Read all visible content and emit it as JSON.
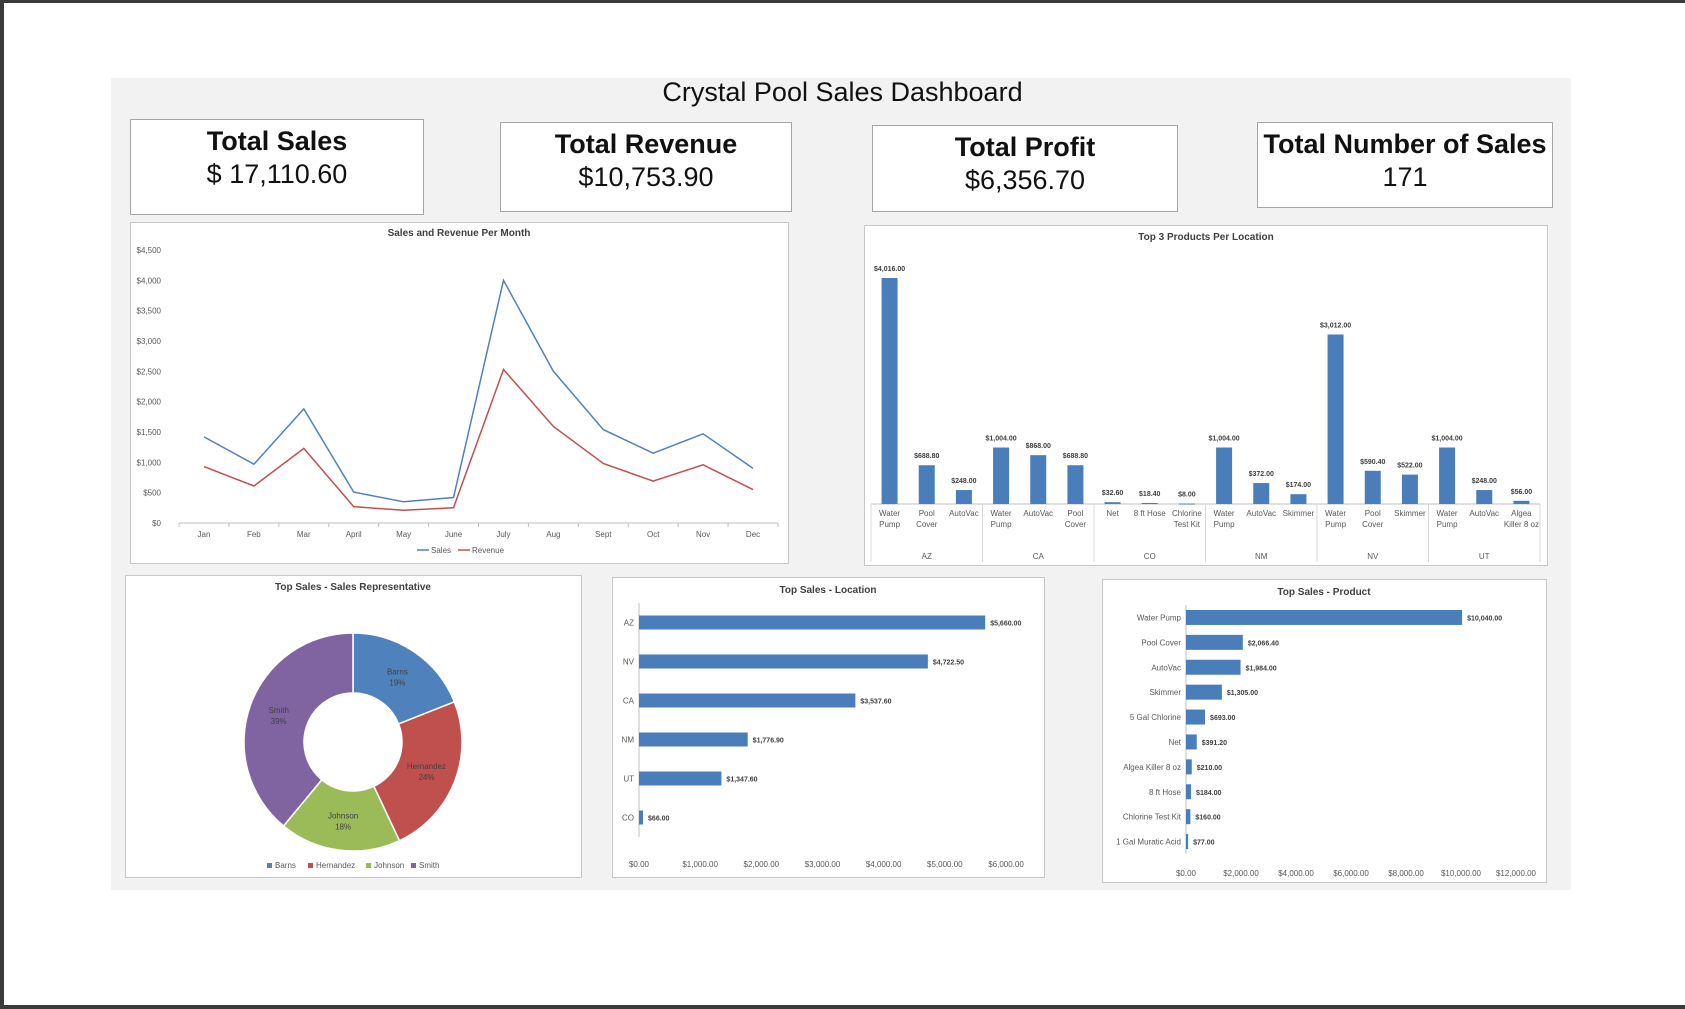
{
  "dashboard": {
    "title": "Crystal Pool Sales Dashboard",
    "kpis": [
      {
        "label": "Total Sales",
        "value": "$ 17,110.60"
      },
      {
        "label": "Total Revenue",
        "value": "$10,753.90"
      },
      {
        "label": "Total Profit",
        "value": "$6,356.70"
      },
      {
        "label": "Total Number of Sales",
        "value": "171"
      }
    ]
  },
  "colors": {
    "blue": "#4f81bd",
    "red": "#c0504d",
    "green": "#9bbb59",
    "purple": "#8064a2",
    "bar": "#4a7ebb"
  },
  "chart_data": [
    {
      "id": "line",
      "type": "line",
      "title": "Sales and Revenue Per Month",
      "categories": [
        "Jan",
        "Feb",
        "Mar",
        "April",
        "May",
        "June",
        "July",
        "Aug",
        "Sept",
        "Oct",
        "Nov",
        "Dec"
      ],
      "series": [
        {
          "name": "Sales",
          "values": [
            1420,
            970,
            1880,
            510,
            350,
            420,
            4000,
            2500,
            1540,
            1150,
            1470,
            900
          ]
        },
        {
          "name": "Revenue",
          "values": [
            930,
            610,
            1230,
            270,
            210,
            250,
            2530,
            1590,
            980,
            690,
            960,
            550
          ]
        }
      ],
      "ylim": [
        0,
        4500
      ],
      "yticks": [
        "$0",
        "$500",
        "$1,000",
        "$1,500",
        "$2,000",
        "$2,500",
        "$3,000",
        "$3,500",
        "$4,000",
        "$4,500"
      ],
      "legend": "bottom",
      "grid": false
    },
    {
      "id": "top3",
      "type": "bar",
      "title": "Top 3 Products Per Location",
      "groups": [
        {
          "name": "AZ",
          "items": [
            {
              "category": "Water Pump",
              "value": 4016.0,
              "label": "$4,016.00"
            },
            {
              "category": "Pool Cover",
              "value": 688.8,
              "label": "$688.80"
            },
            {
              "category": "AutoVac",
              "value": 248.0,
              "label": "$248.00"
            }
          ]
        },
        {
          "name": "CA",
          "items": [
            {
              "category": "Water Pump",
              "value": 1004.0,
              "label": "$1,004.00"
            },
            {
              "category": "AutoVac",
              "value": 868.0,
              "label": "$868.00"
            },
            {
              "category": "Pool Cover",
              "value": 688.8,
              "label": "$688.80"
            }
          ]
        },
        {
          "name": "CO",
          "items": [
            {
              "category": "Net",
              "value": 32.6,
              "label": "$32.60"
            },
            {
              "category": "8 ft Hose",
              "value": 18.4,
              "label": "$18.40"
            },
            {
              "category": "Chlorine Test Kit",
              "value": 8.0,
              "label": "$8.00"
            }
          ]
        },
        {
          "name": "NM",
          "items": [
            {
              "category": "Water Pump",
              "value": 1004.0,
              "label": "$1,004.00"
            },
            {
              "category": "AutoVac",
              "value": 372.0,
              "label": "$372.00"
            },
            {
              "category": "Skimmer",
              "value": 174.0,
              "label": "$174.00"
            }
          ]
        },
        {
          "name": "NV",
          "items": [
            {
              "category": "Water Pump",
              "value": 3012.0,
              "label": "$3,012.00"
            },
            {
              "category": "Pool Cover",
              "value": 590.4,
              "label": "$590.40"
            },
            {
              "category": "Skimmer",
              "value": 522.0,
              "label": "$522.00"
            }
          ]
        },
        {
          "name": "UT",
          "items": [
            {
              "category": "Water Pump",
              "value": 1004.0,
              "label": "$1,004.00"
            },
            {
              "category": "AutoVac",
              "value": 248.0,
              "label": "$248.00"
            },
            {
              "category": "Algea Killer 8 oz",
              "value": 56.0,
              "label": "$56.00"
            }
          ]
        }
      ],
      "ylim": [
        0,
        4016
      ]
    },
    {
      "id": "donut",
      "type": "pie",
      "title": "Top Sales - Sales Representative",
      "slices": [
        {
          "name": "Barns",
          "percent": 19,
          "label": "19%"
        },
        {
          "name": "Hernandez",
          "percent": 24,
          "label": "24%"
        },
        {
          "name": "Johnson",
          "percent": 18,
          "label": "18%"
        },
        {
          "name": "Smith",
          "percent": 39,
          "label": "39%"
        }
      ],
      "legend": "bottom"
    },
    {
      "id": "loc",
      "type": "bar",
      "orientation": "horizontal",
      "title": "Top Sales - Location",
      "categories": [
        "AZ",
        "NV",
        "CA",
        "NM",
        "UT",
        "CO"
      ],
      "values": [
        5660.0,
        4722.5,
        3537.6,
        1776.9,
        1347.6,
        66.0
      ],
      "labels": [
        "$5,660.00",
        "$4,722.50",
        "$3,537.60",
        "$1,776.90",
        "$1,347.60",
        "$66.00"
      ],
      "xlim": [
        0,
        6000
      ],
      "xticks": [
        "$0.00",
        "$1,000.00",
        "$2,000.00",
        "$3,000.00",
        "$4,000.00",
        "$5,000.00",
        "$6,000.00"
      ]
    },
    {
      "id": "prod",
      "type": "bar",
      "orientation": "horizontal",
      "title": "Top Sales - Product",
      "categories": [
        "Water Pump",
        "Pool Cover",
        "AutoVac",
        "Skimmer",
        "5 Gal Chlorine",
        "Net",
        "Algea Killer 8 oz",
        "8 ft Hose",
        "Chlorine Test Kit",
        "1 Gal Muratic Acid"
      ],
      "values": [
        10040.0,
        2066.4,
        1984.0,
        1305.0,
        693.0,
        391.2,
        210.0,
        184.0,
        160.0,
        77.0
      ],
      "labels": [
        "$10,040.00",
        "$2,066.40",
        "$1,984.00",
        "$1,305.00",
        "$693.00",
        "$391.20",
        "$210.00",
        "$184.00",
        "$160.00",
        "$77.00"
      ],
      "xlim": [
        0,
        12000
      ],
      "xticks": [
        "$0.00",
        "$2,000.00",
        "$4,000.00",
        "$6,000.00",
        "$8,000.00",
        "$10,000.00",
        "$12,000.00"
      ]
    }
  ]
}
